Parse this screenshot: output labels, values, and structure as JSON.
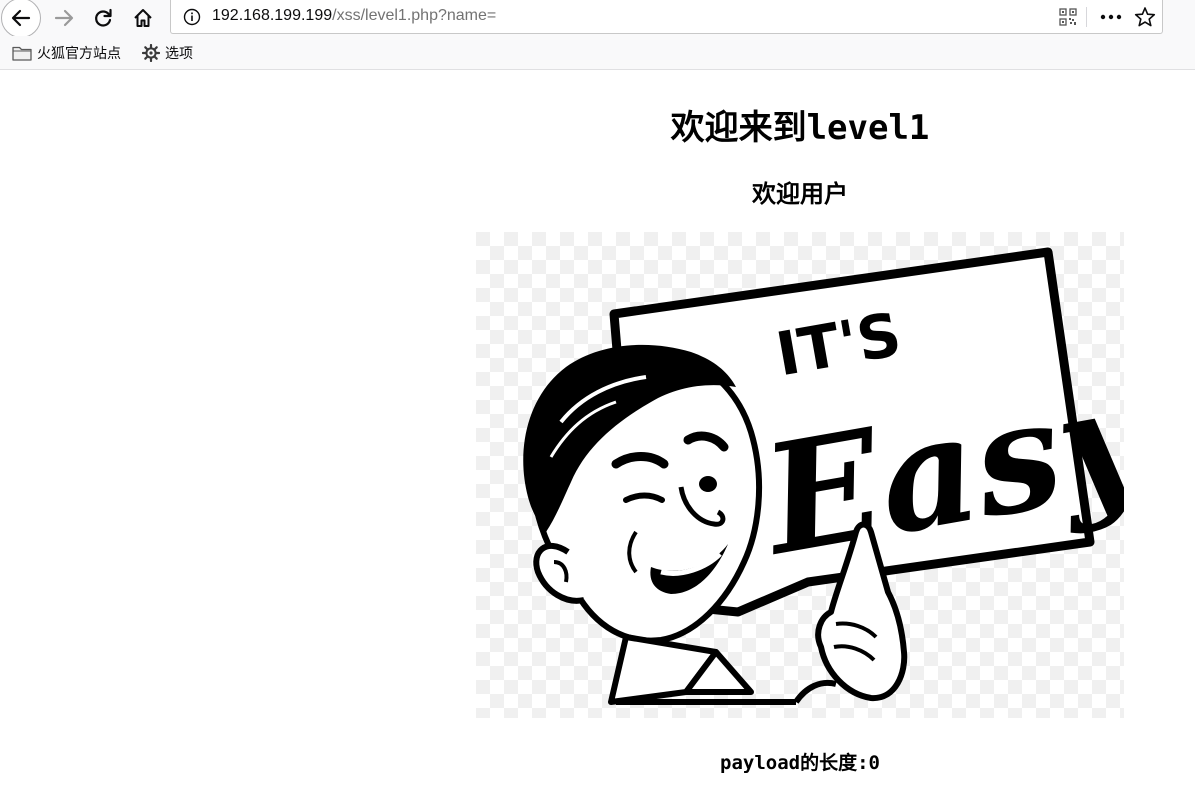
{
  "browser": {
    "url_host": "192.168.199.199",
    "url_path": "/xss/level1.php?name=",
    "bookmarks": [
      {
        "label": "火狐官方站点",
        "icon": "folder-icon"
      },
      {
        "label": "选项",
        "icon": "gear-icon"
      }
    ]
  },
  "page": {
    "heading_text": "欢迎来到",
    "heading_level": "level1",
    "welcome_text": "欢迎用户",
    "image_text": {
      "top": "IT'S",
      "main": "Easy"
    },
    "payload_label": "payload的长度:0"
  },
  "colors": {
    "toolbar_bg": "#f9f9fa",
    "text": "#0c0c0d",
    "dim_url": "#737373",
    "page_bg": "#ffffff"
  }
}
